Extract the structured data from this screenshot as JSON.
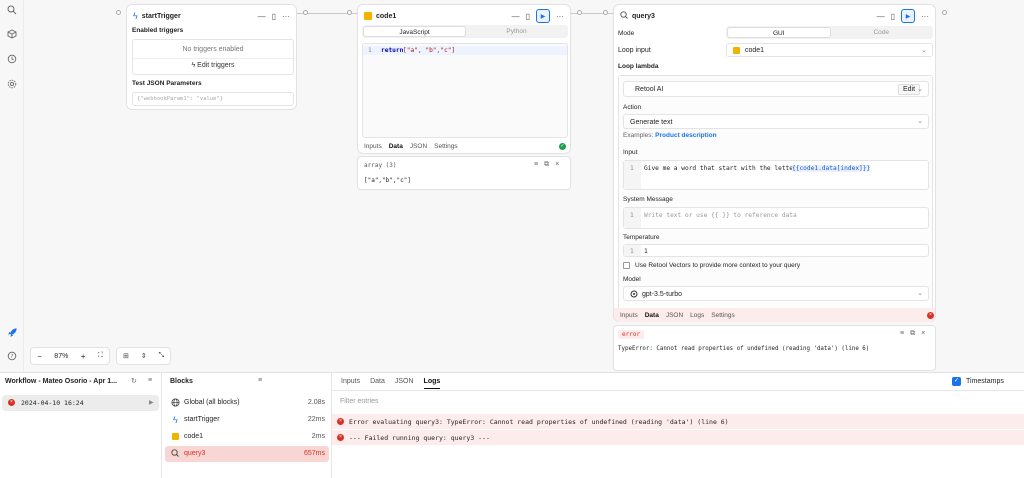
{
  "sidebar_icons": [
    "search-icon",
    "cube-icon",
    "history-icon",
    "settings-icon"
  ],
  "zoom": {
    "minus": "−",
    "value": "87%",
    "plus": "+"
  },
  "trigger_card": {
    "title": "startTrigger",
    "enabled_label": "Enabled triggers",
    "no_triggers": "No triggers enabled",
    "edit_label": "Edit triggers",
    "test_label": "Test JSON Parameters",
    "test_placeholder": "{\"webhookParam1\": \"value\"}"
  },
  "code_card": {
    "title": "code1",
    "lang_tabs": [
      "JavaScript",
      "Python"
    ],
    "line_no": "1",
    "code_keyword": "return",
    "code_rest": " [\"a\", \"b\",\"c\"]",
    "tabs": [
      "Inputs",
      "Data",
      "JSON",
      "Settings"
    ],
    "active_tab": "Data",
    "result_type": "array (3)",
    "result_value": "[\"a\",\"b\",\"c\"]"
  },
  "query_card": {
    "title": "query3",
    "mode_label": "Mode",
    "mode_options": [
      "GUI",
      "Code"
    ],
    "loop_input_label": "Loop input",
    "loop_input_value": "code1",
    "loop_lambda_label": "Loop lambda",
    "resource": "Retool AI",
    "edit_btn": "Edit",
    "action_label": "Action",
    "action_value": "Generate text",
    "examples_prefix": "Examples:",
    "examples_link": "Product description",
    "input_label": "Input",
    "input_line_no": "1",
    "input_text": "Give me a word that start with the letter ",
    "input_template": "{{code1.data[index]}}",
    "system_label": "System Message",
    "system_line_no": "1",
    "system_placeholder": "Write text or use {{ }} to reference data",
    "temp_label": "Temperature",
    "temp_line_no": "1",
    "temp_value": "1",
    "vectors_label": "Use Retool Vectors to provide more context to your query",
    "model_label": "Model",
    "model_value": "gpt-3.5-turbo",
    "tabs": [
      "Inputs",
      "Data",
      "JSON",
      "Logs",
      "Settings"
    ],
    "active_tab": "Data",
    "error_badge": "error",
    "error_text": "TypeError: Cannot read properties of undefined (reading 'data') (line 6)"
  },
  "bottom": {
    "workflow_title": "Workflow - Mateo Osorio - Apr 1...",
    "run_timestamp": "2024-04-10 16:24",
    "blocks_title": "Blocks",
    "blocks": [
      {
        "name": "Global (all blocks)",
        "time": "2.08s",
        "icon": "globe-icon"
      },
      {
        "name": "startTrigger",
        "time": "22ms",
        "icon": "bolt-icon"
      },
      {
        "name": "code1",
        "time": "2ms",
        "icon": "js-icon"
      },
      {
        "name": "query3",
        "time": "657ms",
        "icon": "ai-icon"
      }
    ],
    "tabs": [
      "Inputs",
      "Data",
      "JSON",
      "Logs"
    ],
    "active_tab": "Logs",
    "timestamps_label": "Timestamps",
    "filter_placeholder": "Filter entries",
    "logs": [
      "Error evaluating query3: TypeError: Cannot read properties of undefined (reading 'data') (line 6)",
      "--- Failed running query: query3 ---"
    ]
  },
  "colors": {
    "accent": "#1a73e8",
    "error": "#d93025",
    "error_bg": "#fdecec"
  }
}
